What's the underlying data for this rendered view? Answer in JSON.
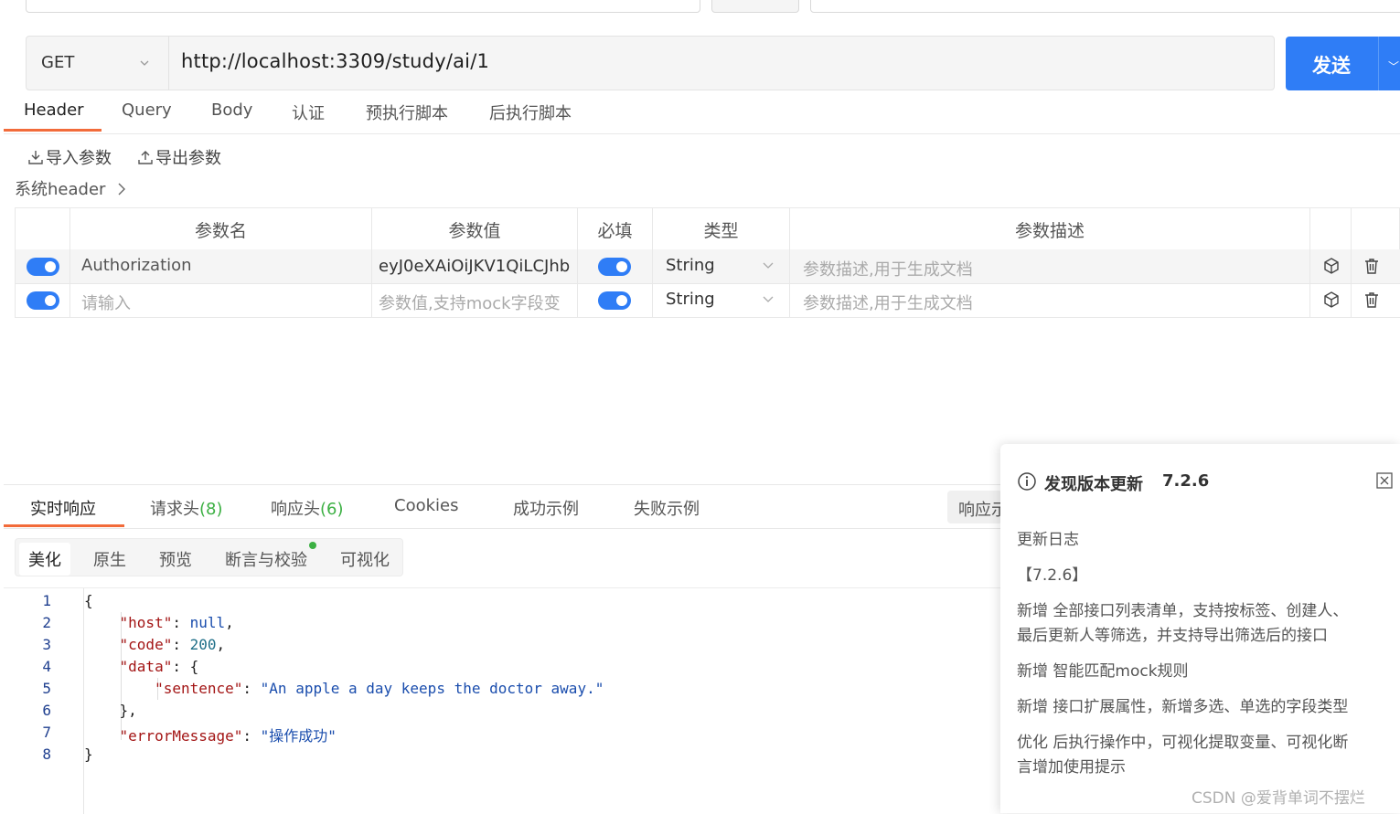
{
  "request": {
    "method": "GET",
    "url": "http://localhost:3309/study/ai/1",
    "send_label": "发送"
  },
  "request_tabs": [
    "Header",
    "Query",
    "Body",
    "认证",
    "预执行脚本",
    "后执行脚本"
  ],
  "toolbar": {
    "import_label": "导入参数",
    "export_label": "导出参数",
    "system_header_label": "系统header"
  },
  "params_table": {
    "headers": [
      "参数名",
      "参数值",
      "必填",
      "类型",
      "参数描述"
    ],
    "rows": [
      {
        "enabled": true,
        "name": "Authorization",
        "name_is_placeholder": false,
        "value": "eyJ0eXAiOiJKV1QiLCJhb",
        "value_is_placeholder": false,
        "required": true,
        "type": "String",
        "description_placeholder": "参数描述,用于生成文档"
      },
      {
        "enabled": true,
        "name": "请输入",
        "name_is_placeholder": true,
        "value": "参数值,支持mock字段变",
        "value_is_placeholder": true,
        "required": true,
        "type": "String",
        "description_placeholder": "参数描述,用于生成文档"
      }
    ]
  },
  "response_tabs": {
    "realtime": "实时响应",
    "req_headers": "请求头",
    "req_headers_count": "(8)",
    "resp_headers": "响应头",
    "resp_headers_count": "(6)",
    "cookies": "Cookies",
    "success_example": "成功示例",
    "fail_example": "失败示例",
    "resp_example": "响应示"
  },
  "view_tabs": [
    "美化",
    "原生",
    "预览",
    "断言与校验",
    "可视化"
  ],
  "code": {
    "line_numbers": [
      "1",
      "2",
      "3",
      "4",
      "5",
      "6",
      "7",
      "8"
    ],
    "host_key": "\"host\"",
    "host_val": "null",
    "code_key": "\"code\"",
    "code_val": "200",
    "data_key": "\"data\"",
    "sentence_key": "\"sentence\"",
    "sentence_val": "\"An apple a day keeps the doctor away.\"",
    "error_key": "\"errorMessage\"",
    "error_val": "\"操作成功\""
  },
  "update_notice": {
    "title": "发现版本更新",
    "version": "7.2.6",
    "log_title": "更新日志",
    "version_tag": "【7.2.6】",
    "lines": [
      "新增 全部接口列表清单，支持按标签、创建人、",
      "最后更新人等筛选，并支持导出筛选后的接口",
      "新增 智能匹配mock规则",
      "新增 接口扩展属性，新增多选、单选的字段类型",
      "优化 后执行操作中，可视化提取变量、可视化断",
      "言增加使用提示"
    ]
  },
  "watermark": "CSDN @爱背单词不摆烂",
  "colors": {
    "primary": "#2f7df6",
    "tab_accent": "#f26b3a",
    "count_green": "#3cb043"
  }
}
